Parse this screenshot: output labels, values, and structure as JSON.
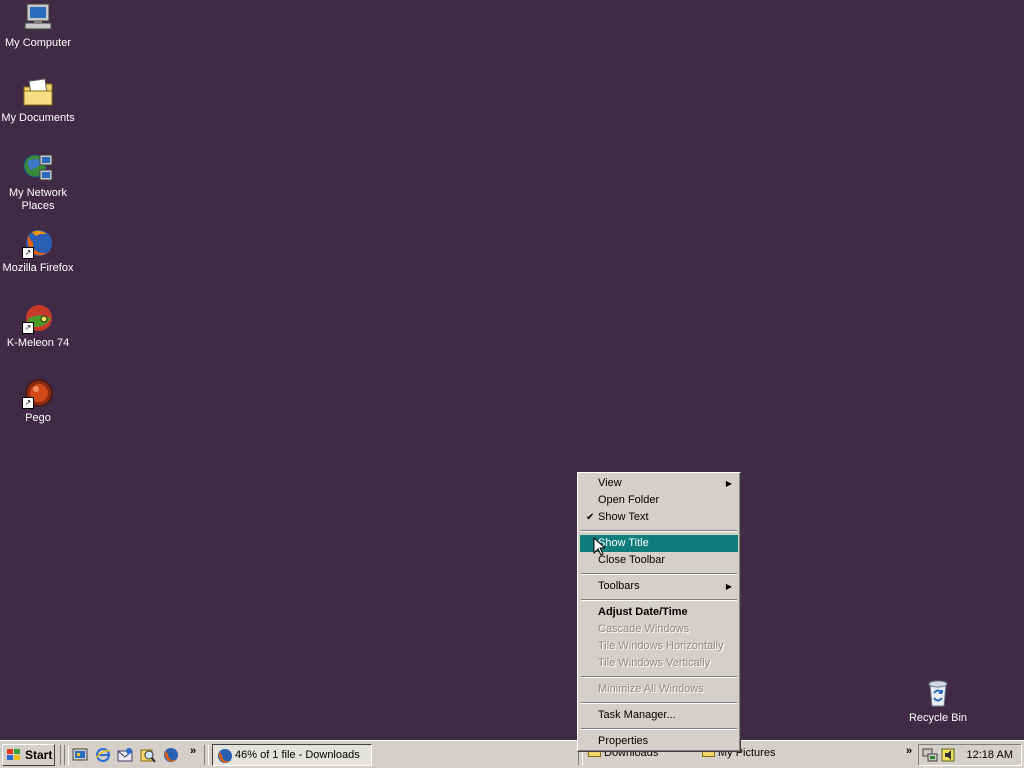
{
  "desktop": {
    "icons": [
      {
        "label": "My Computer",
        "icon": "my-computer-icon"
      },
      {
        "label": "My Documents",
        "icon": "my-documents-icon"
      },
      {
        "label": "My Network Places",
        "icon": "network-places-icon"
      },
      {
        "label": "Mozilla Firefox",
        "icon": "firefox-icon"
      },
      {
        "label": "K-Meleon 74",
        "icon": "kmeleon-icon"
      },
      {
        "label": "Pego",
        "icon": "pego-icon"
      },
      {
        "label": "Recycle Bin",
        "icon": "recycle-bin-icon"
      }
    ],
    "background_color": "#412a45"
  },
  "context_menu": {
    "items": [
      {
        "label": "View",
        "submenu": true
      },
      {
        "label": "Open Folder"
      },
      {
        "label": "Show Text",
        "checked": true
      },
      {
        "label": "Show Title",
        "highlighted": true
      },
      {
        "label": "Close Toolbar"
      },
      {
        "label": "Toolbars",
        "submenu": true
      },
      {
        "label": "Adjust Date/Time",
        "bold": true
      },
      {
        "label": "Cascade Windows",
        "disabled": true
      },
      {
        "label": "Tile Windows Horizontally",
        "disabled": true
      },
      {
        "label": "Tile Windows Vertically",
        "disabled": true
      },
      {
        "label": "Minimize All Windows",
        "disabled": true
      },
      {
        "label": "Task Manager..."
      },
      {
        "label": "Properties"
      }
    ],
    "highlight_color": "#0f7d7b"
  },
  "taskbar": {
    "start_label": "Start",
    "task_button": "46% of 1 file - Downloads",
    "toolbar_folders": [
      "Downloads",
      "My Pictures"
    ],
    "overflow_chevron": "»",
    "clock": "12:18 AM"
  }
}
